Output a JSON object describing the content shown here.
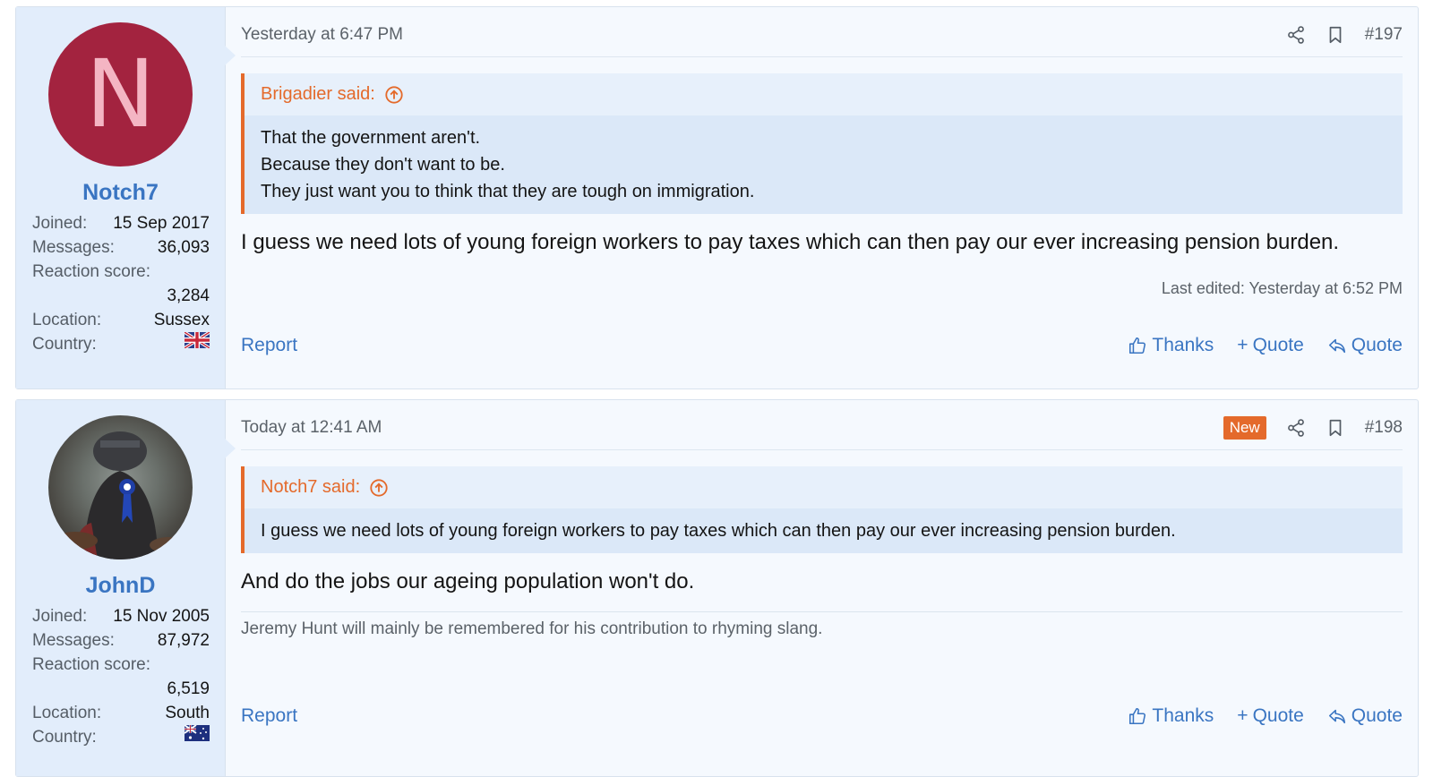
{
  "posts": [
    {
      "user": {
        "avatar_letter": "N",
        "name": "Notch7",
        "joined_label": "Joined:",
        "joined": "15 Sep 2017",
        "messages_label": "Messages:",
        "messages": "36,093",
        "reaction_label": "Reaction score:",
        "reaction": "3,284",
        "location_label": "Location:",
        "location": "Sussex",
        "country_label": "Country:",
        "flag": "uk-flag-icon"
      },
      "date": "Yesterday at 6:47 PM",
      "number": "#197",
      "quote": {
        "author": "Brigadier said:",
        "lines": [
          "That the government aren't.",
          "Because they don't want to be.",
          "They just want you to think that they are tough on immigration."
        ]
      },
      "message": "I guess we need lots of young foreign workers to pay taxes which can then pay our ever increasing pension burden.",
      "edited": "Last edited: Yesterday at 6:52 PM",
      "report": "Report",
      "thanks": "Thanks",
      "multiquote": "Quote",
      "reply": "Quote"
    },
    {
      "user": {
        "name": "JohnD",
        "joined_label": "Joined:",
        "joined": "15 Nov 2005",
        "messages_label": "Messages:",
        "messages": "87,972",
        "reaction_label": "Reaction score:",
        "reaction": "6,519",
        "location_label": "Location:",
        "location": "South",
        "country_label": "Country:",
        "flag": "australia-flag-icon"
      },
      "date": "Today at 12:41 AM",
      "badge": "New",
      "number": "#198",
      "quote": {
        "author": "Notch7 said:",
        "lines": [
          "I guess we need lots of young foreign workers to pay taxes which can then pay our ever increasing pension burden."
        ]
      },
      "message": "And do the jobs our ageing population won't do.",
      "signature": "Jeremy Hunt will mainly be remembered for his contribution to rhyming slang.",
      "report": "Report",
      "thanks": "Thanks",
      "multiquote": "Quote",
      "reply": "Quote"
    }
  ],
  "colors": {
    "link": "#3a75c2",
    "quote_accent": "#e46a2b",
    "avatar_bg": "#a3233f",
    "user_panel": "#e2edfb"
  }
}
